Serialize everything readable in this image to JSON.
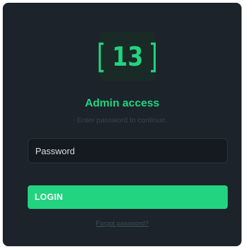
{
  "logo": {
    "left_bracket": "[",
    "number": "13",
    "right_bracket": "]"
  },
  "header": {
    "title": "Admin access",
    "subtitle": "Enter password to continue."
  },
  "form": {
    "password_placeholder": "Password",
    "password_value": "",
    "login_label": "LOGIN",
    "forgot_label": "Forgot password?"
  },
  "colors": {
    "accent": "#22d47f",
    "card_background": "#1c232b",
    "input_background": "#141a20"
  },
  "icons": [
    "logo-13-icon"
  ]
}
